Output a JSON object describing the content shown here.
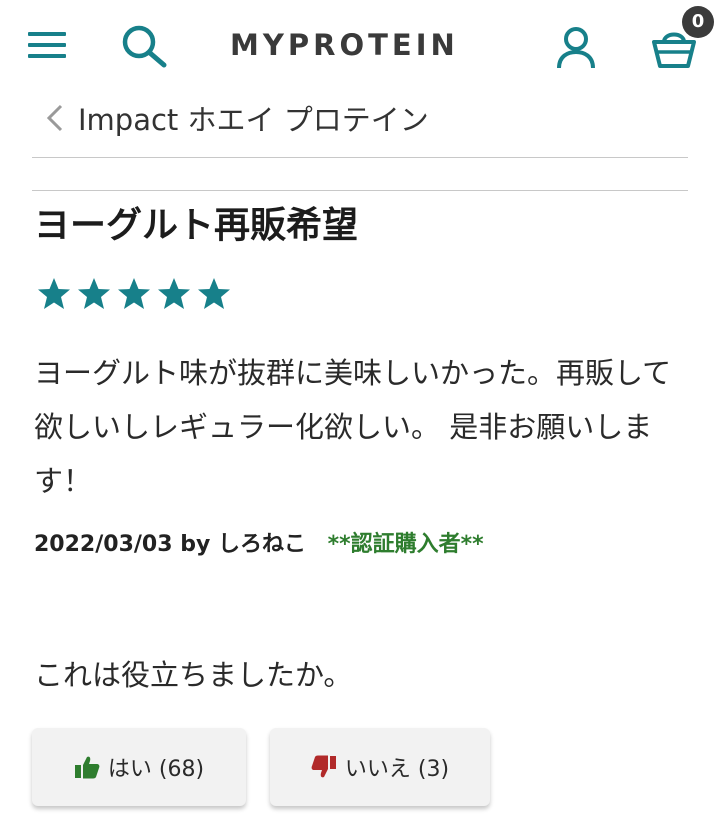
{
  "header": {
    "logo_text": "MYPROTEIN",
    "basket_count": "0",
    "accent_color": "#17808a",
    "icons": [
      "menu-icon",
      "search-icon",
      "account-icon",
      "basket-icon"
    ]
  },
  "breadcrumb": {
    "label": "Impact ホエイ プロテイン"
  },
  "review": {
    "title": "ヨーグルト再販希望",
    "rating": 5,
    "rating_max": 5,
    "body": "ヨーグルト味が抜群に美味しいかった。再販して欲しいしレギュラー化欲しい。 是非お願いします！",
    "date_by": "2022/03/03 by しろねこ",
    "verified": "**認証購入者**",
    "verified_color": "#2e7d2e"
  },
  "helpful": {
    "question": "これは役立ちましたか。",
    "yes_label": "はい (68)",
    "no_label": "いいえ (3)",
    "yes_color": "#2e7d2e",
    "no_color": "#b12a2a"
  }
}
